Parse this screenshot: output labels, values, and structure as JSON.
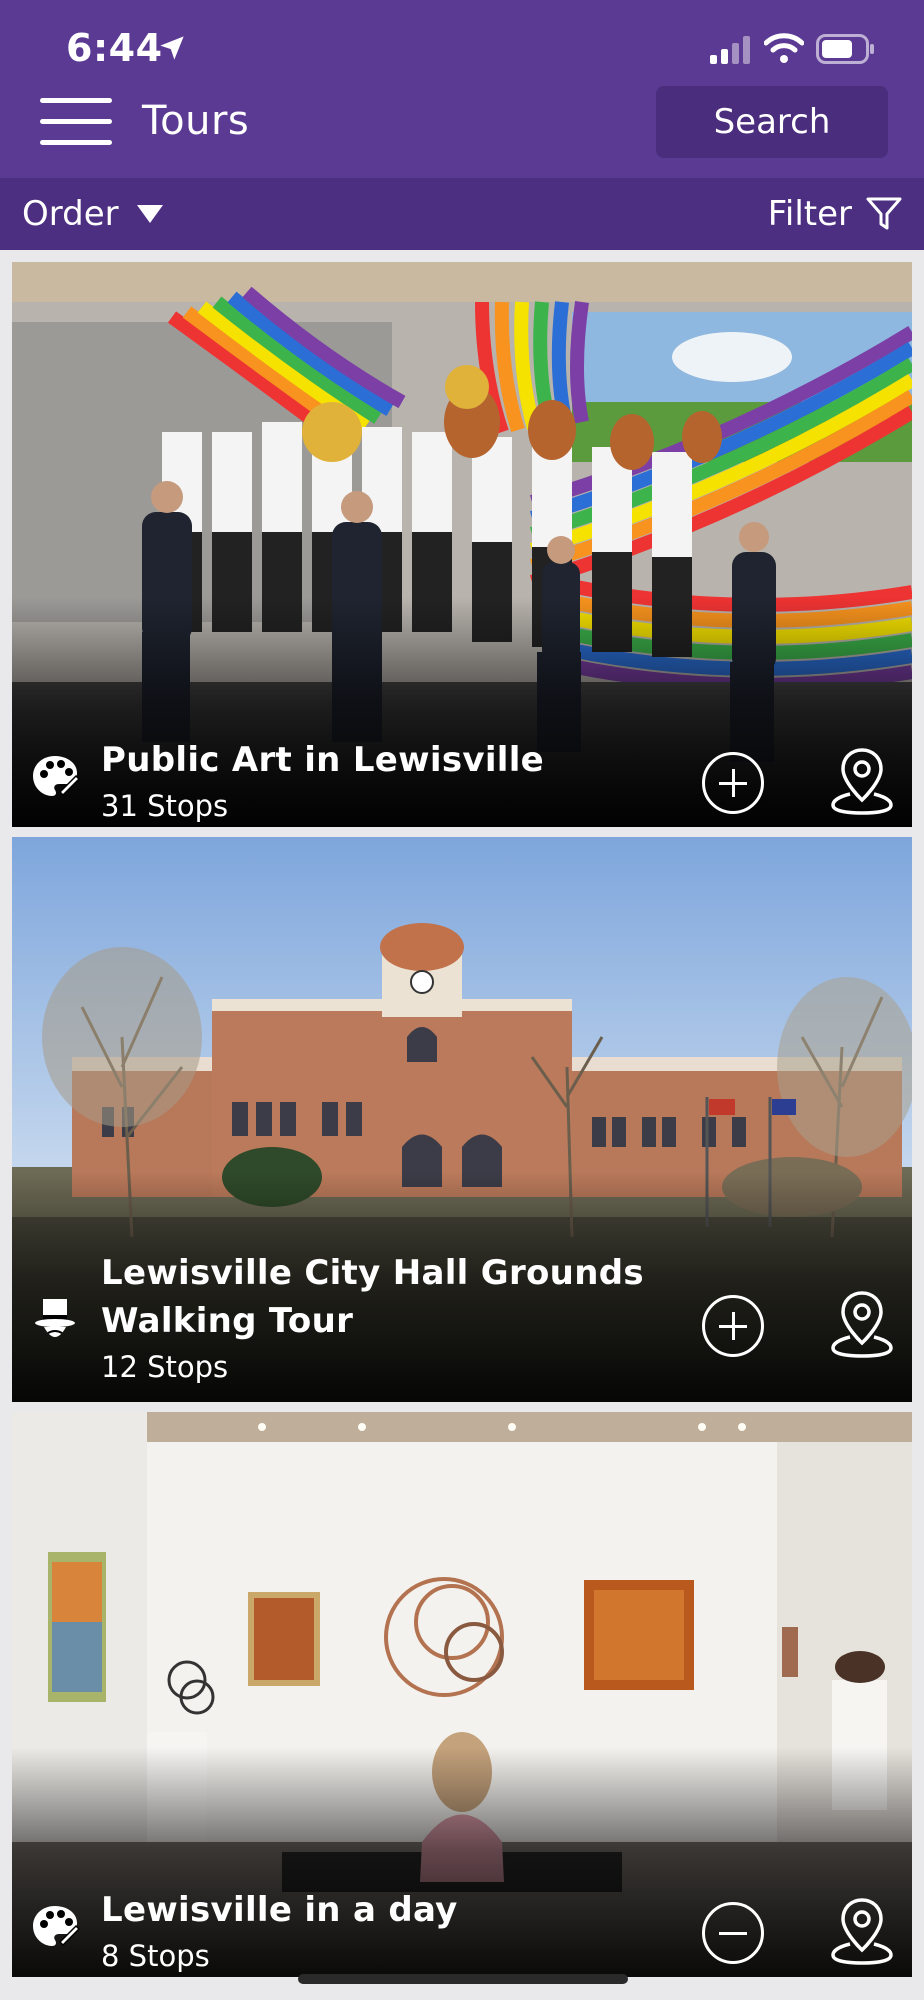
{
  "status_bar": {
    "time": "6:44"
  },
  "header": {
    "title": "Tours",
    "search_label": "Search",
    "order_label": "Order",
    "filter_label": "Filter"
  },
  "tours": [
    {
      "title": "Public Art in Lewisville",
      "stops": "31 Stops",
      "category_icon": "palette-icon",
      "action": "add"
    },
    {
      "title_line1": "Lewisville City Hall Grounds",
      "title_line2": "Walking Tour",
      "stops": "12 Stops",
      "category_icon": "top-hat-icon",
      "action": "add"
    },
    {
      "title": "Lewisville in a day",
      "stops": "8 Stops",
      "category_icon": "palette-icon",
      "action": "remove"
    }
  ],
  "colors": {
    "header_bg": "#5b3a93",
    "subbar_bg": "#4d2f82",
    "search_bg": "#4a2d7c"
  }
}
